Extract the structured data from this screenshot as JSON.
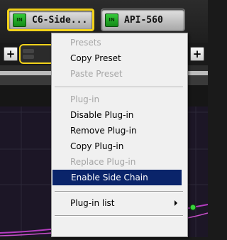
{
  "tabs": [
    {
      "badge": "IN",
      "name": "C6-Side..."
    },
    {
      "badge": "IN",
      "name": "API-560"
    }
  ],
  "buttons": {
    "add_left": "+",
    "add_right": "+"
  },
  "menu": {
    "presets_header": "Presets",
    "copy_preset": "Copy Preset",
    "paste_preset": "Paste Preset",
    "plugin_header": "Plug-in",
    "disable_plugin": "Disable Plug-in",
    "remove_plugin": "Remove Plug-in",
    "copy_plugin": "Copy Plug-in",
    "replace_plugin": "Replace Plug-in",
    "enable_side_chain": "Enable Side Chain",
    "plugin_list": "Plug-in list"
  },
  "colors": {
    "selected_outline": "#f2d21a",
    "in_badge": "#2db532",
    "menu_highlight": "#0a246a"
  }
}
